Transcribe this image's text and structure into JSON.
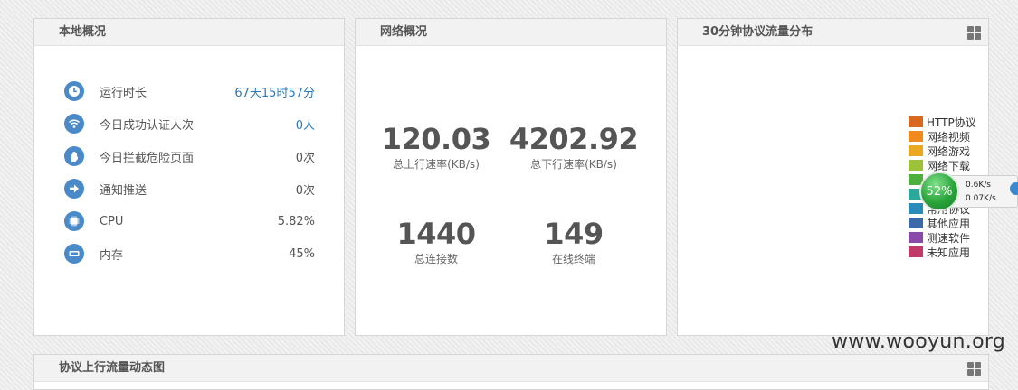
{
  "panels": {
    "local": {
      "title": "本地概况",
      "rows": [
        {
          "icon": "clock-icon",
          "label": "运行时长",
          "value": "67天15时57分",
          "link": true
        },
        {
          "icon": "wifi-icon",
          "label": "今日成功认证人次",
          "value": "0人",
          "link": true
        },
        {
          "icon": "hand-stop-icon",
          "label": "今日拦截危险页面",
          "value": "0次",
          "link": false
        },
        {
          "icon": "arrow-right-icon",
          "label": "通知推送",
          "value": "0次",
          "link": false
        },
        {
          "icon": "cpu-icon",
          "label": "CPU",
          "value": "5.82%",
          "link": false
        },
        {
          "icon": "memory-icon",
          "label": "内存",
          "value": "45%",
          "link": false
        }
      ]
    },
    "network": {
      "title": "网络概况",
      "upload_rate": {
        "value": "120.03",
        "label": "总上行速率(KB/s)"
      },
      "download_rate": {
        "value": "4202.92",
        "label": "总下行速率(KB/s)"
      },
      "connections": {
        "value": "1440",
        "label": "总连接数"
      },
      "terminals": {
        "value": "149",
        "label": "在线终端"
      }
    },
    "protocol": {
      "title": "30分钟协议流量分布",
      "legend": [
        {
          "label": "HTTP协议",
          "color": "#d9691e"
        },
        {
          "label": "网络视频",
          "color": "#ef8a1f"
        },
        {
          "label": "网络游戏",
          "color": "#e8a820"
        },
        {
          "label": "网络下载",
          "color": "#9cc23a"
        },
        {
          "label": "",
          "color": "#4caf3e"
        },
        {
          "label": "",
          "color": "#2aa89a"
        },
        {
          "label": "常用协议",
          "color": "#2a8ab8"
        },
        {
          "label": "其他应用",
          "color": "#3a6aa8"
        },
        {
          "label": "测速软件",
          "color": "#8a4aa8"
        },
        {
          "label": "未知应用",
          "color": "#c03a6a"
        }
      ]
    },
    "bottom": {
      "title": "协议上行流量动态图"
    }
  },
  "speed_widget": {
    "percent": "52%",
    "up": "0.6K/s",
    "down": "0.07K/s"
  },
  "watermark": "www.wooyun.org"
}
